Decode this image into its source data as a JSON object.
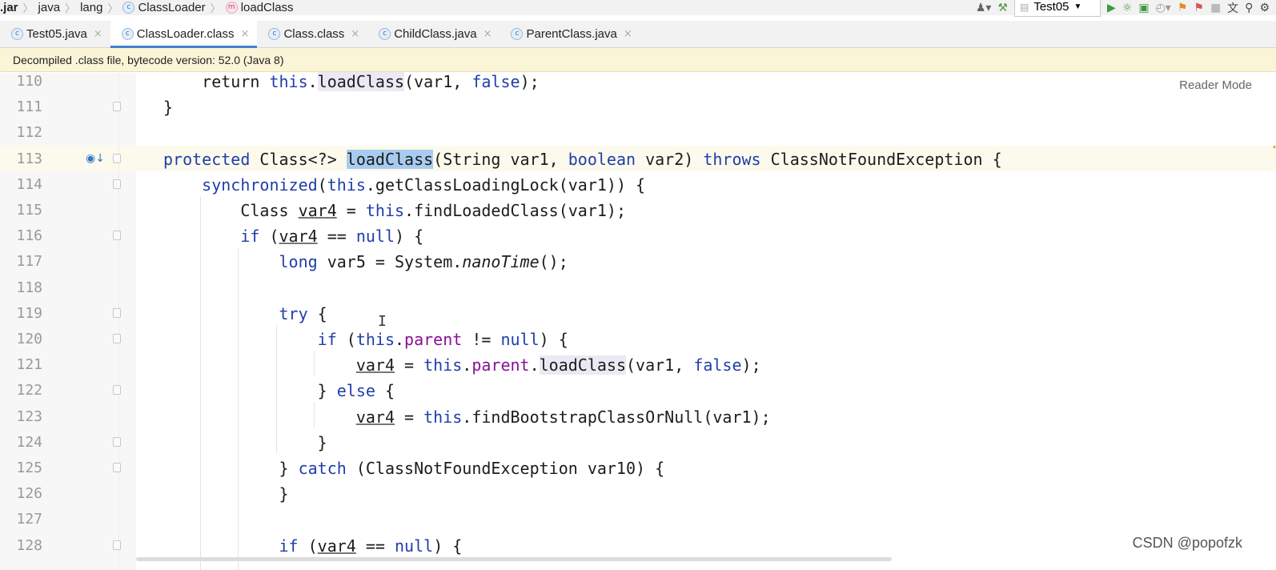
{
  "breadcrumb": {
    "items": [
      {
        "label": ".jar",
        "icon": ""
      },
      {
        "label": "java",
        "icon": ""
      },
      {
        "label": "lang",
        "icon": ""
      },
      {
        "label": "ClassLoader",
        "icon": "class-icon"
      },
      {
        "label": "loadClass",
        "icon": "method-icon"
      }
    ]
  },
  "toolbar": {
    "run_config": "Test05",
    "icons": [
      "user-icon",
      "build-hammer-icon",
      "run-icon",
      "debug-icon",
      "coverage-icon",
      "profile-icon",
      "attach-icon",
      "stop-icon",
      "translate-icon",
      "search-icon",
      "settings-icon"
    ]
  },
  "tabs": [
    {
      "label": "Test05.java",
      "active": false
    },
    {
      "label": "ClassLoader.class",
      "active": true
    },
    {
      "label": "Class.class",
      "active": false
    },
    {
      "label": "ChildClass.java",
      "active": false
    },
    {
      "label": "ParentClass.java",
      "active": false
    }
  ],
  "banner": {
    "text": "Decompiled .class file, bytecode version: 52.0 (Java 8)"
  },
  "reader_mode": "Reader Mode",
  "watermark": "CSDN @popofzk",
  "code": {
    "lines": [
      {
        "n": "110",
        "tokens": [
          [
            "",
            "    return "
          ],
          [
            "kw",
            "this"
          ],
          [
            "",
            "."
          ],
          [
            "hl",
            "loadClass"
          ],
          [
            "",
            "(var1, "
          ],
          [
            "kw",
            "false"
          ],
          [
            "",
            ");"
          ]
        ]
      },
      {
        "n": "111",
        "tokens": [
          [
            "",
            "}"
          ]
        ]
      },
      {
        "n": "112",
        "tokens": []
      },
      {
        "n": "113",
        "tokens": [
          [
            "kw",
            "protected "
          ],
          [
            "",
            "Class<?> "
          ],
          [
            "sel",
            "loadClass"
          ],
          [
            "",
            "(String var1, "
          ],
          [
            "kw",
            "boolean "
          ],
          [
            "",
            "var2) "
          ],
          [
            "kw",
            "throws "
          ],
          [
            "",
            "ClassNotFoundException {"
          ]
        ]
      },
      {
        "n": "114",
        "tokens": [
          [
            "",
            "    "
          ],
          [
            "kw",
            "synchronized"
          ],
          [
            "",
            "("
          ],
          [
            "kw",
            "this"
          ],
          [
            "",
            ".getClassLoadingLock(var1)) {"
          ]
        ]
      },
      {
        "n": "115",
        "tokens": [
          [
            "",
            "        Class "
          ],
          [
            "ul",
            "var4"
          ],
          [
            "",
            " = "
          ],
          [
            "kw",
            "this"
          ],
          [
            "",
            ".findLoadedClass(var1);"
          ]
        ]
      },
      {
        "n": "116",
        "tokens": [
          [
            "",
            "        "
          ],
          [
            "kw",
            "if "
          ],
          [
            "",
            "("
          ],
          [
            "ul",
            "var4"
          ],
          [
            "",
            " == "
          ],
          [
            "kw",
            "null"
          ],
          [
            "",
            ") {"
          ]
        ]
      },
      {
        "n": "117",
        "tokens": [
          [
            "",
            "            "
          ],
          [
            "kw",
            "long "
          ],
          [
            "",
            "var5 = System."
          ],
          [
            "it",
            "nanoTime"
          ],
          [
            "",
            "();"
          ]
        ]
      },
      {
        "n": "118",
        "tokens": []
      },
      {
        "n": "119",
        "tokens": [
          [
            "",
            "            "
          ],
          [
            "kw",
            "try "
          ],
          [
            "",
            "{"
          ]
        ]
      },
      {
        "n": "120",
        "tokens": [
          [
            "",
            "                "
          ],
          [
            "kw",
            "if "
          ],
          [
            "",
            "("
          ],
          [
            "kw",
            "this"
          ],
          [
            "",
            "."
          ],
          [
            "fld",
            "parent"
          ],
          [
            "",
            " != "
          ],
          [
            "kw",
            "null"
          ],
          [
            "",
            ") {"
          ]
        ]
      },
      {
        "n": "121",
        "tokens": [
          [
            "",
            "                    "
          ],
          [
            "ul",
            "var4"
          ],
          [
            "",
            " = "
          ],
          [
            "kw",
            "this"
          ],
          [
            "",
            "."
          ],
          [
            "fld",
            "parent"
          ],
          [
            "",
            "."
          ],
          [
            "hl",
            "loadClass"
          ],
          [
            "",
            "(var1, "
          ],
          [
            "kw",
            "false"
          ],
          [
            "",
            ");"
          ]
        ]
      },
      {
        "n": "122",
        "tokens": [
          [
            "",
            "                } "
          ],
          [
            "kw",
            "else "
          ],
          [
            "",
            "{"
          ]
        ]
      },
      {
        "n": "123",
        "tokens": [
          [
            "",
            "                    "
          ],
          [
            "ul",
            "var4"
          ],
          [
            "",
            " = "
          ],
          [
            "kw",
            "this"
          ],
          [
            "",
            ".findBootstrapClassOrNull(var1);"
          ]
        ]
      },
      {
        "n": "124",
        "tokens": [
          [
            "",
            "                }"
          ]
        ]
      },
      {
        "n": "125",
        "tokens": [
          [
            "",
            "            } "
          ],
          [
            "kw",
            "catch "
          ],
          [
            "",
            "(ClassNotFoundException var10) {"
          ]
        ]
      },
      {
        "n": "126",
        "tokens": [
          [
            "",
            "            }"
          ]
        ]
      },
      {
        "n": "127",
        "tokens": []
      },
      {
        "n": "128",
        "tokens": [
          [
            "",
            "            "
          ],
          [
            "kw",
            "if "
          ],
          [
            "",
            "("
          ],
          [
            "ul",
            "var4"
          ],
          [
            "",
            " == "
          ],
          [
            "kw",
            "null"
          ],
          [
            "",
            ") {"
          ]
        ]
      }
    ]
  }
}
